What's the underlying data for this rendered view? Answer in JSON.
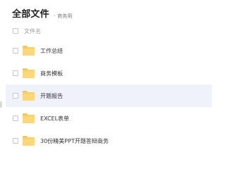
{
  "header": {
    "title": "全部文件",
    "breadcrumb_separator": "›",
    "breadcrumb_current": "商务用"
  },
  "columns": {
    "name_header": "文件名"
  },
  "files": [
    {
      "name": "工作总结",
      "icon": "folder-icon"
    },
    {
      "name": "商务模板",
      "icon": "folder-icon"
    },
    {
      "name": "开题报告",
      "icon": "folder-icon"
    },
    {
      "name": "EXCEL表单",
      "icon": "folder-icon"
    },
    {
      "name": "30份精美PPT开题答辩商务",
      "icon": "folder-icon"
    }
  ],
  "colors": {
    "hover_row": "#f0f2fb",
    "folder": "#f8cf6a"
  }
}
